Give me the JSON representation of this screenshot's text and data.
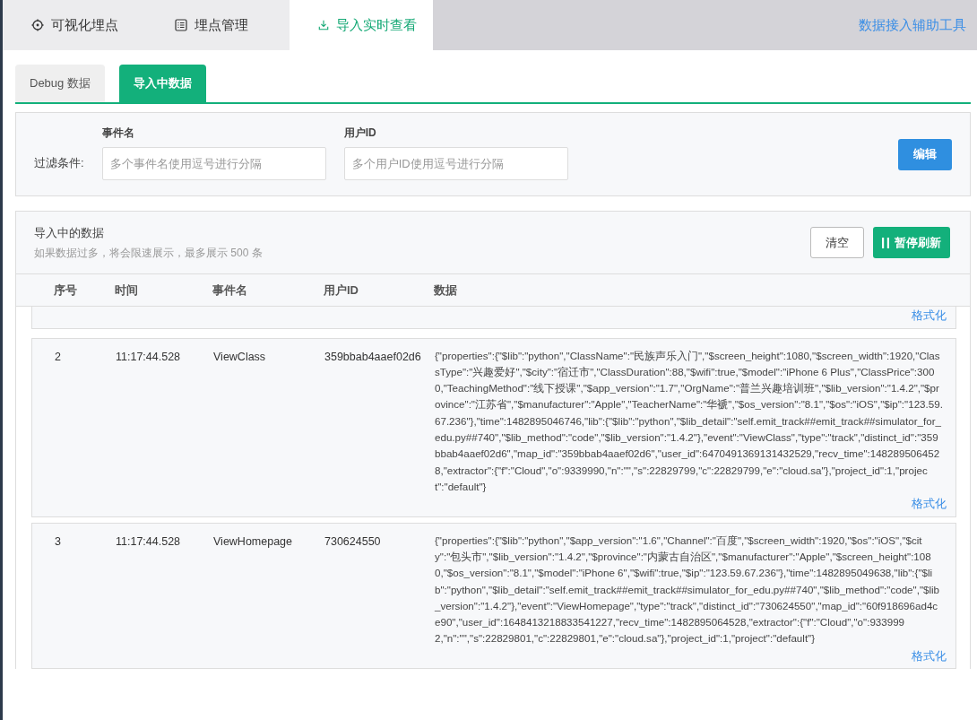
{
  "top_tabs": [
    {
      "label": "可视化埋点",
      "kind": "target",
      "selected": false
    },
    {
      "label": "埋点管理",
      "kind": "list",
      "selected": false
    },
    {
      "label": "导入实时查看",
      "kind": "download",
      "selected": true
    }
  ],
  "top_link": "数据接入辅助工具",
  "sub_tabs": [
    {
      "label": "Debug 数据",
      "selected": false
    },
    {
      "label": "导入中数据",
      "selected": true
    }
  ],
  "filter": {
    "label": "过滤条件:",
    "fields": [
      {
        "label": "事件名",
        "placeholder": "多个事件名使用逗号进行分隔"
      },
      {
        "label": "用户ID",
        "placeholder": "多个用户ID使用逗号进行分隔"
      }
    ],
    "edit_button": "编辑"
  },
  "data_panel": {
    "title": "导入中的数据",
    "subtitle": "如果数据过多，将会限速展示，最多展示 500 条",
    "clear_button": "清空",
    "pause_button": "暂停刷新",
    "columns": [
      "序号",
      "时间",
      "事件名",
      "用户ID",
      "数据"
    ],
    "rows": [
      {
        "format_link": "格式化"
      },
      {
        "index": "2",
        "time": "11:17:44.528",
        "event": "ViewClass",
        "user_id": "359bbab4aaef02d6",
        "data": "{\"properties\":{\"$lib\":\"python\",\"ClassName\":\"民族声乐入门\",\"$screen_height\":1080,\"$screen_width\":1920,\"ClassType\":\"兴趣爱好\",\"$city\":\"宿迁市\",\"ClassDuration\":88,\"$wifi\":true,\"$model\":\"iPhone 6 Plus\",\"ClassPrice\":3000,\"TeachingMethod\":\"线下授课\",\"$app_version\":\"1.7\",\"OrgName\":\"普兰兴趣培训班\",\"$lib_version\":\"1.4.2\",\"$province\":\"江苏省\",\"$manufacturer\":\"Apple\",\"TeacherName\":\"华褫\",\"$os_version\":\"8.1\",\"$os\":\"iOS\",\"$ip\":\"123.59.67.236\"},\"time\":1482895046746,\"lib\":{\"$lib\":\"python\",\"$lib_detail\":\"self.emit_track##emit_track##simulator_for_edu.py##740\",\"$lib_method\":\"code\",\"$lib_version\":\"1.4.2\"},\"event\":\"ViewClass\",\"type\":\"track\",\"distinct_id\":\"359bbab4aaef02d6\",\"map_id\":\"359bbab4aaef02d6\",\"user_id\":6470491369131432529,\"recv_time\":1482895064528,\"extractor\":{\"f\":\"Cloud\",\"o\":9339990,\"n\":\"\",\"s\":22829799,\"c\":22829799,\"e\":\"cloud.sa\"},\"project_id\":1,\"project\":\"default\"}",
        "format_link": "格式化"
      },
      {
        "index": "3",
        "time": "11:17:44.528",
        "event": "ViewHomepage",
        "user_id": "730624550",
        "data": "{\"properties\":{\"$lib\":\"python\",\"$app_version\":\"1.6\",\"Channel\":\"百度\",\"$screen_width\":1920,\"$os\":\"iOS\",\"$city\":\"包头市\",\"$lib_version\":\"1.4.2\",\"$province\":\"内蒙古自治区\",\"$manufacturer\":\"Apple\",\"$screen_height\":1080,\"$os_version\":\"8.1\",\"$model\":\"iPhone 6\",\"$wifi\":true,\"$ip\":\"123.59.67.236\"},\"time\":1482895049638,\"lib\":{\"$lib\":\"python\",\"$lib_detail\":\"self.emit_track##emit_track##simulator_for_edu.py##740\",\"$lib_method\":\"code\",\"$lib_version\":\"1.4.2\"},\"event\":\"ViewHomepage\",\"type\":\"track\",\"distinct_id\":\"730624550\",\"map_id\":\"60f918696ad4ce90\",\"user_id\":1648413218833541227,\"recv_time\":1482895064528,\"extractor\":{\"f\":\"Cloud\",\"o\":9339992,\"n\":\"\",\"s\":22829801,\"c\":22829801,\"e\":\"cloud.sa\"},\"project_id\":1,\"project\":\"default\"}",
        "format_link": "格式化"
      }
    ]
  }
}
